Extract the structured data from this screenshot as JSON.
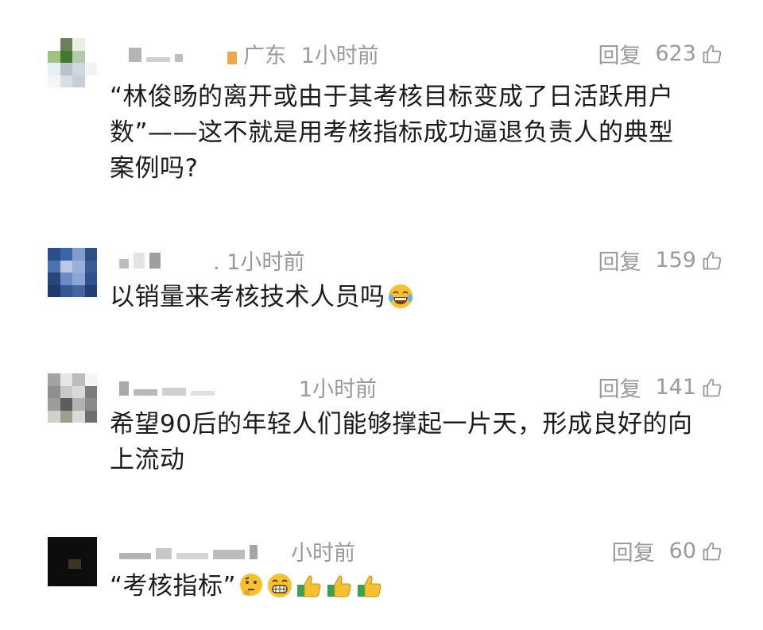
{
  "comments": [
    {
      "region": "广东",
      "time": "1小时前",
      "reply_label": "回复",
      "likes": "623",
      "text_line1": "“林俊旸的离开或由于其考核目标变成了日活跃用户",
      "text_line2": "数”——这不就是用考核指标成功逼退负责人的典型",
      "text_line3": "案例吗?"
    },
    {
      "time": ". 1小时前",
      "reply_label": "回复",
      "likes": "159",
      "text_line1": "以销量来考核技术人员吗"
    },
    {
      "time": "1小时前",
      "reply_label": "回复",
      "likes": "141",
      "text_line1": "希望90后的年轻人们能够撑起一片天，形成良好的向",
      "text_line2": "上流动"
    },
    {
      "time": "小时前",
      "reply_label": "回复",
      "likes": "60",
      "text_line1": "“考核指标”"
    }
  ],
  "icons": {
    "like": "thumbs-up-outline-icon",
    "region": "location-badge-icon",
    "emoji_laugh": "tears-of-joy-emoji",
    "emoji_think": "thinking-emoji",
    "emoji_grin": "grinning-emoji",
    "emoji_thumb": "thumbs-up-emoji"
  },
  "colors": {
    "meta_gray": "#9a9a9a",
    "text_dark": "#1c1c1c",
    "emoji_yellow": "#f6c02f",
    "thumb_green": "#3aa14c"
  }
}
